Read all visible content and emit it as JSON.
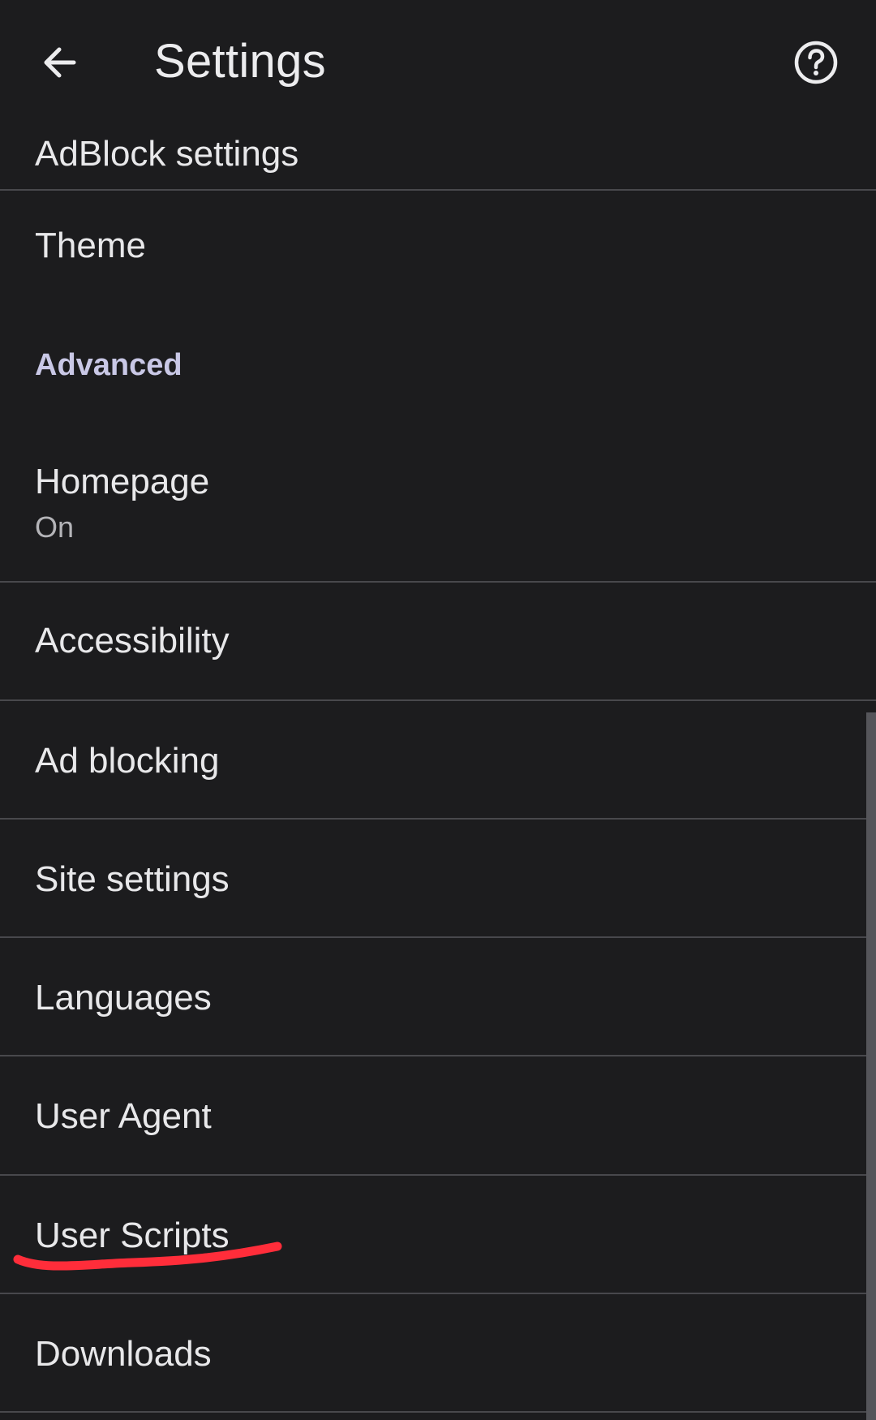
{
  "app_bar": {
    "title": "Settings",
    "back_icon": "arrow-left-icon",
    "help_icon": "help-circle-icon"
  },
  "settings": {
    "adblock_settings": "AdBlock settings",
    "theme": "Theme",
    "advanced_header": "Advanced",
    "homepage": {
      "label": "Homepage",
      "summary": "On"
    },
    "accessibility": "Accessibility",
    "ad_blocking": "Ad blocking",
    "site_settings": "Site settings",
    "languages": "Languages",
    "user_agent": "User Agent",
    "user_scripts": "User Scripts",
    "downloads": "Downloads"
  },
  "colors": {
    "background": "#1c1c1e",
    "divider": "#48484c",
    "section_header": "#c9c8e6",
    "annotation": "#ff2d3a"
  }
}
